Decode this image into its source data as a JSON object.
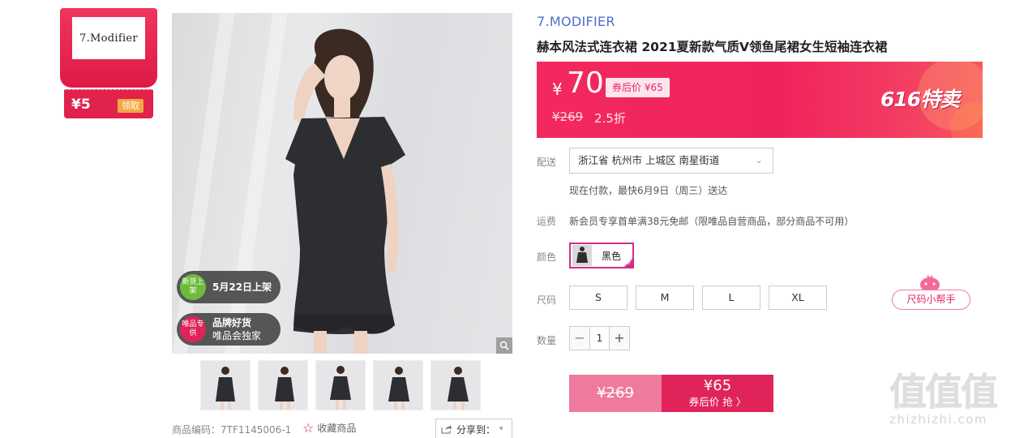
{
  "brand_coupon": {
    "logo_text": "7.Modifier",
    "amount": "¥5",
    "claim_label": "领取"
  },
  "gallery": {
    "badges": [
      {
        "icon_text": "新货上架",
        "text": "5月22日上架",
        "subtext": "",
        "color": "#6dbb3b"
      },
      {
        "icon_text": "唯品专供",
        "text": "品牌好货",
        "subtext": "唯品会独家",
        "color": "#e0245a"
      }
    ],
    "zoom_icon": "magnifier-icon",
    "thumbnail_count": 5
  },
  "footer": {
    "sku_code": "商品编码：7TF1145006-1",
    "favorite_label": "收藏商品",
    "share_label": "分享到："
  },
  "product": {
    "brand": "7.MODIFIER",
    "title": "赫本风法式连衣裙 2021夏新款气质V领鱼尾裙女生短袖连衣裙"
  },
  "price": {
    "currency": "¥",
    "value": "70",
    "after_coupon_tag": "券后价 ¥65",
    "original": "¥269",
    "discount": "2.5折",
    "event_logo": "616特卖"
  },
  "delivery": {
    "label": "配送",
    "address": "浙江省 杭州市 上城区 南星街道",
    "eta": "现在付款，最快6月9日（周三）送达"
  },
  "freight": {
    "label": "运费",
    "text": "新会员专享首单满38元免邮（限唯品自营商品，部分商品不可用）"
  },
  "color": {
    "label": "颜色",
    "selected": "黑色"
  },
  "size": {
    "label": "尺码",
    "options": [
      "S",
      "M",
      "L",
      "XL"
    ],
    "helper_label": "尺码小帮手"
  },
  "quantity": {
    "label": "数量",
    "minus": "−",
    "value": "1",
    "plus": "+"
  },
  "buy": {
    "original_price": "¥269",
    "price": "¥65",
    "action_label": "券后价 抢 〉"
  },
  "watermark": {
    "chars": "值值值",
    "domain": "zhizhizhi.com"
  },
  "colors": {
    "accent_pink": "#e0245a",
    "brand_blue": "#4a6fc9",
    "select_magenta": "#d32c8c"
  }
}
